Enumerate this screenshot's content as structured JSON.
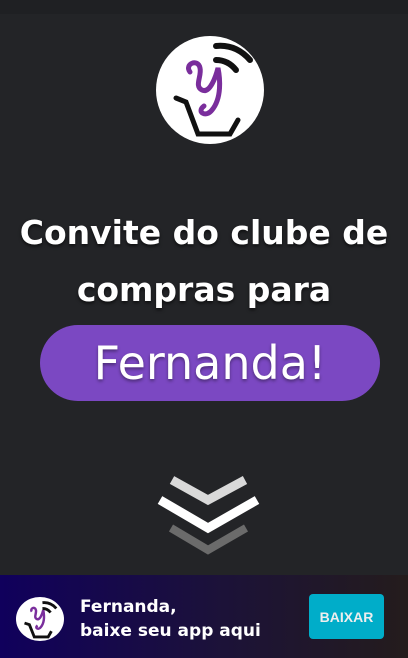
{
  "heading": {
    "line1": "Convite do clube de",
    "line2": "compras para"
  },
  "name_pill": "Fernanda!",
  "scroll_indicator": "chevron-down-icon",
  "banner": {
    "line1": "Fernanda,",
    "line2": "baixe seu app aqui",
    "button": "BAIXAR"
  },
  "colors": {
    "background": "#232427",
    "accent": "#7b48c2",
    "button": "#00adc9"
  }
}
